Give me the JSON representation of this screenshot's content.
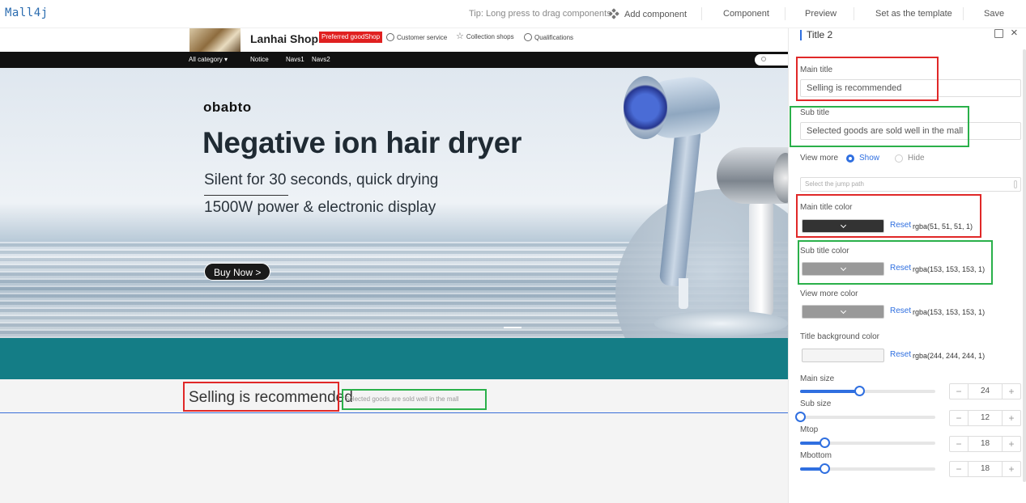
{
  "app": {
    "logo": "Mall4j"
  },
  "toolbar": {
    "tip": "Tip: Long press to drag components",
    "add_component": "Add component",
    "component": "Component",
    "preview": "Preview",
    "set_template": "Set as the template",
    "save": "Save"
  },
  "shop": {
    "name": "Lanhai Shop",
    "badge": "Preferred goodShop",
    "links": [
      "Customer service",
      "Collection shops",
      "Qualifications"
    ]
  },
  "nav": {
    "items": [
      "All category ▾",
      "Notice",
      "Navs1",
      "Navs2"
    ]
  },
  "banner": {
    "brand": "obabto",
    "headline": "Negative ion hair dryer",
    "line1": "Silent for 30 seconds, quick drying",
    "line2": "1500W power & electronic display",
    "cta": "Buy Now >"
  },
  "section": {
    "main_title": "Selling is recommended",
    "sub_title": "Selected goods are sold well in the mall"
  },
  "panel": {
    "title": "Title 2",
    "main_title_label": "Main title",
    "main_title_value": "Selling is recommended",
    "sub_title_label": "Sub title",
    "sub_title_value": "Selected goods are sold well in the mall",
    "view_more_label": "View more",
    "view_more_options": [
      "Show",
      "Hide"
    ],
    "view_more_selected": "Show",
    "jump_path_placeholder": "Select the jump path",
    "reset_label": "Reset",
    "colors": [
      {
        "label": "Main title color",
        "value": "rgba(51, 51, 51, 1)",
        "hex": "#333333"
      },
      {
        "label": "Sub title color",
        "value": "rgba(153, 153, 153, 1)",
        "hex": "#999999"
      },
      {
        "label": "View more color",
        "value": "rgba(153, 153, 153, 1)",
        "hex": "#999999"
      },
      {
        "label": "Title background color",
        "value": "rgba(244, 244, 244, 1)",
        "hex": "#f4f4f4"
      }
    ],
    "sliders": [
      {
        "label": "Main size",
        "value": "24",
        "fraction": 0.44
      },
      {
        "label": "Sub size",
        "value": "12",
        "fraction": 0.0
      },
      {
        "label": "Mtop",
        "value": "18",
        "fraction": 0.18
      },
      {
        "label": "Mbottom",
        "value": "18",
        "fraction": 0.18
      }
    ],
    "accent": "#2f6fe0"
  },
  "highlight_colors": {
    "red": "#e02828",
    "green": "#2ab04a"
  }
}
